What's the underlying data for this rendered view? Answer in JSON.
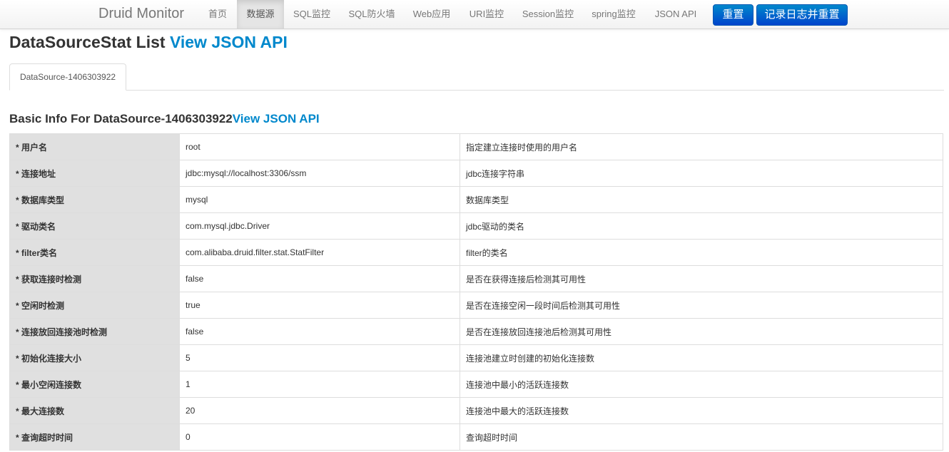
{
  "navbar": {
    "brand": "Druid Monitor",
    "items": [
      {
        "label": "首页"
      },
      {
        "label": "数据源"
      },
      {
        "label": "SQL监控"
      },
      {
        "label": "SQL防火墙"
      },
      {
        "label": "Web应用"
      },
      {
        "label": "URI监控"
      },
      {
        "label": "Session监控"
      },
      {
        "label": "spring监控"
      },
      {
        "label": "JSON API"
      }
    ],
    "active_item": "数据源",
    "reset_button": "重置",
    "log_reset_button": "记录日志并重置"
  },
  "page": {
    "title": "DataSourceStat List",
    "title_link": "View JSON API"
  },
  "tabs": [
    {
      "label": "DataSource-1406303922"
    }
  ],
  "section": {
    "title": "Basic Info For DataSource-1406303922",
    "title_link": "View JSON API"
  },
  "table": {
    "rows": [
      {
        "label": "* 用户名",
        "value": "root",
        "desc": "指定建立连接时使用的用户名"
      },
      {
        "label": "* 连接地址",
        "value": "jdbc:mysql://localhost:3306/ssm",
        "desc": "jdbc连接字符串"
      },
      {
        "label": "* 数据库类型",
        "value": "mysql",
        "desc": "数据库类型"
      },
      {
        "label": "* 驱动类名",
        "value": "com.mysql.jdbc.Driver",
        "desc": "jdbc驱动的类名"
      },
      {
        "label": "* filter类名",
        "value": "com.alibaba.druid.filter.stat.StatFilter",
        "desc": "filter的类名"
      },
      {
        "label": "* 获取连接时检测",
        "value": "false",
        "desc": "是否在获得连接后检测其可用性"
      },
      {
        "label": "* 空闲时检测",
        "value": "true",
        "desc": "是否在连接空闲一段时间后检测其可用性"
      },
      {
        "label": "* 连接放回连接池时检测",
        "value": "false",
        "desc": "是否在连接放回连接池后检测其可用性"
      },
      {
        "label": "* 初始化连接大小",
        "value": "5",
        "desc": "连接池建立时创建的初始化连接数"
      },
      {
        "label": "* 最小空闲连接数",
        "value": "1",
        "desc": "连接池中最小的活跃连接数"
      },
      {
        "label": "* 最大连接数",
        "value": "20",
        "desc": "连接池中最大的活跃连接数"
      },
      {
        "label": "* 查询超时时间",
        "value": "0",
        "desc": "查询超时时间"
      }
    ]
  },
  "colors": {
    "link": "#0088cc",
    "button": "#0055cc",
    "label_cell_bg": "#e0e0e0",
    "active_nav_bg": "#e5e5e5"
  }
}
